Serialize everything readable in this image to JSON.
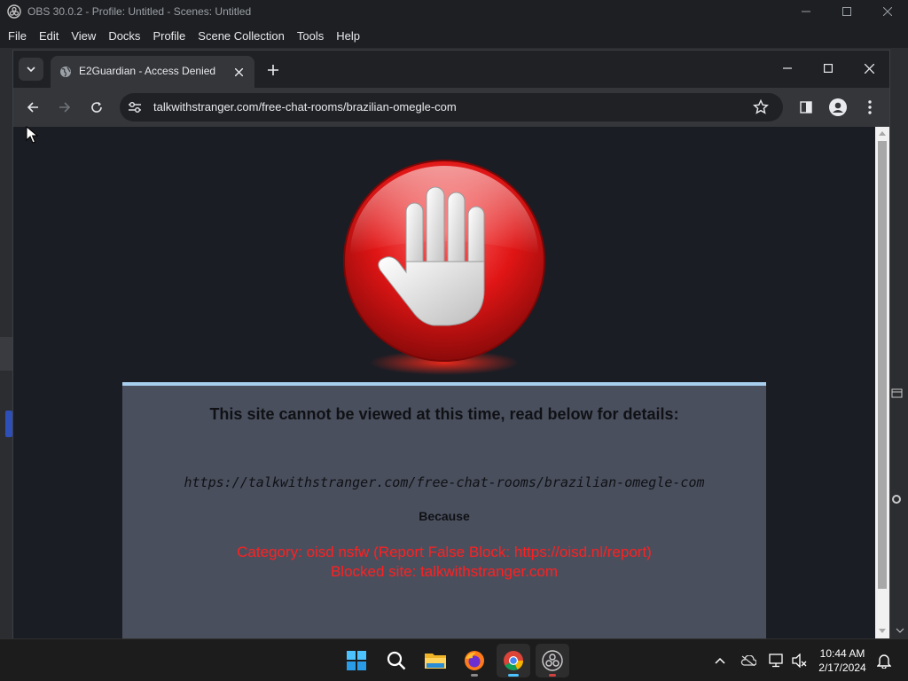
{
  "obs": {
    "title": "OBS 30.0.2 - Profile: Untitled - Scenes: Untitled",
    "menu": [
      "File",
      "Edit",
      "View",
      "Docks",
      "Profile",
      "Scene Collection",
      "Tools",
      "Help"
    ]
  },
  "browser": {
    "tab": {
      "title": "E2Guardian - Access Denied",
      "favicon": "globe-icon"
    },
    "url": "talkwithstranger.com/free-chat-rooms/brazilian-omegle-com"
  },
  "page": {
    "heading": "This site cannot be viewed at this time, read below for details:",
    "blocked_url": "https://talkwithstranger.com/free-chat-rooms/brazilian-omegle-com",
    "because": "Because",
    "category": "Category: oisd nsfw (Report False Block: https://oisd.nl/report)",
    "blocked_site": "Blocked site: talkwithstranger.com",
    "more_text": "",
    "accent_color": "#ff2020"
  },
  "taskbar": {
    "apps": [
      "windows-start-icon",
      "search-icon",
      "file-explorer-icon",
      "firefox-icon",
      "chrome-icon",
      "obs-icon"
    ],
    "time": "10:44 AM",
    "date": "2/17/2024"
  }
}
